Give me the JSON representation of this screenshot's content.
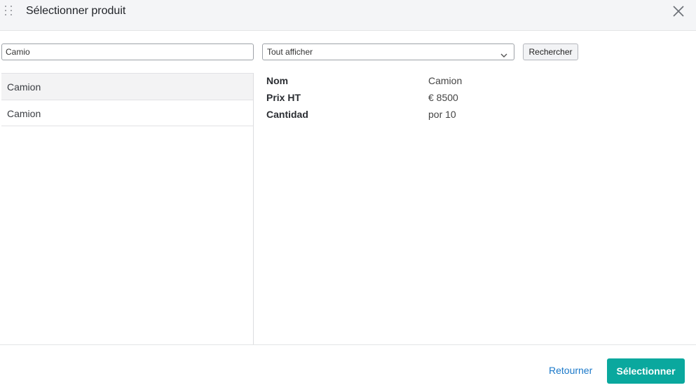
{
  "dialog": {
    "title": "Sélectionner produit",
    "drag_icon": "drag-handle-icon",
    "close_icon": "close-icon"
  },
  "search": {
    "value": "Camio",
    "filter_selected": "Tout afficher",
    "button_label": "Rechercher"
  },
  "results": [
    {
      "label": "Camion",
      "selected": true
    },
    {
      "label": "Camion",
      "selected": false
    }
  ],
  "details": {
    "rows": [
      {
        "key": "Nom",
        "value": "Camion"
      },
      {
        "key": "Prix HT",
        "value": "€ 8500"
      },
      {
        "key": "Cantidad",
        "value": "por 10"
      }
    ]
  },
  "footer": {
    "back_label": "Retourner",
    "select_label": "Sélectionner"
  },
  "colors": {
    "accent": "#0aa89e",
    "link": "#1a78c9"
  }
}
